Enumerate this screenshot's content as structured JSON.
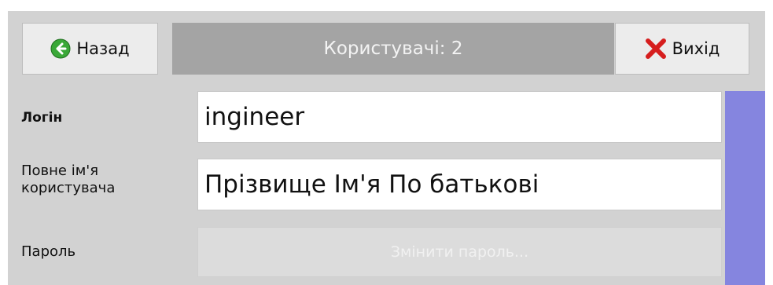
{
  "header": {
    "back_label": "Назад",
    "back_icon": "back-arrow-icon",
    "title": "Користувачі: 2",
    "exit_label": "Вихід",
    "exit_icon": "close-x-icon"
  },
  "form": {
    "login": {
      "label": "Логін",
      "value": "ingineer"
    },
    "full_name": {
      "label_line1": "Повне ім'я",
      "label_line2": "користувача",
      "value": "Прізвище Ім'я По батькові"
    },
    "password": {
      "label": "Пароль",
      "button_label": "Змінити пароль..."
    }
  },
  "colors": {
    "panel_bg": "#d2d2d2",
    "title_bg": "#a4a4a4",
    "scrollbar": "#8585df",
    "back_icon_green": "#3aa838",
    "exit_icon_red": "#d61e1e"
  }
}
